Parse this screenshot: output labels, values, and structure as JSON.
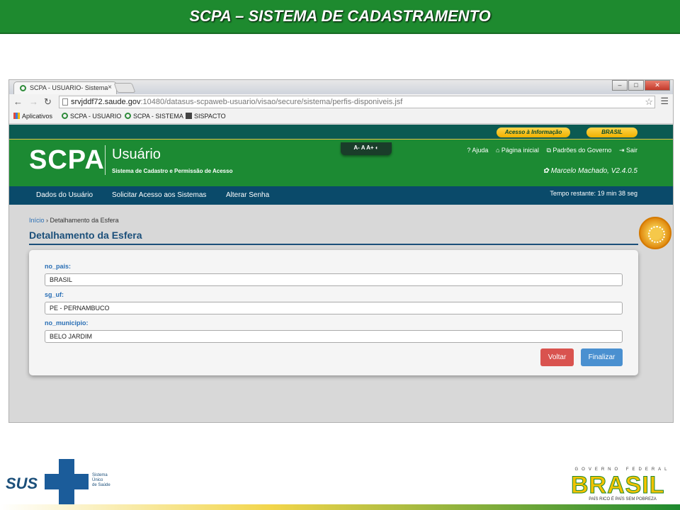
{
  "banner": {
    "title": "SCPA – SISTEMA DE CADASTRAMENTO"
  },
  "browser": {
    "tab_title": "SCPA - USUARIO- Sistema",
    "tab_close": "×",
    "window_controls": {
      "minimize": "–",
      "maximize": "□",
      "close": "✕"
    },
    "url_host": "srvjddf72.saude.gov",
    "url_path": ":10480/datasus-scpaweb-usuario/visao/secure/sistema/perfis-disponiveis.jsf",
    "bookmarks": [
      "Aplicativos",
      "SCPA - USUARIO",
      "SCPA - SISTEMA",
      "SISPACTO"
    ]
  },
  "site": {
    "acesso_info": "Acesso à Informação",
    "brasil_pill": "BRASIL",
    "logo": "SCPA",
    "subtitle": "Usuário",
    "subdesc": "Sistema de Cadastro e Permissão de Acesso",
    "font_controls": "A-  A  A+  ◐",
    "links": {
      "ajuda": "? Ajuda",
      "inicial": "⌂ Página inicial",
      "padroes": "⧉ Padrões do Governo",
      "sair": "⇥ Sair"
    },
    "user": "Marcelo Machado, V2.4.0.5",
    "menu": [
      "Dados do Usuário",
      "Solicitar Acesso aos Sistemas",
      "Alterar Senha"
    ],
    "timer": "Tempo restante: 19 min 38 seg"
  },
  "content": {
    "breadcrumb_home": "Início",
    "breadcrumb_current": "Detalhamento da Esfera",
    "title": "Detalhamento da Esfera",
    "fields": [
      {
        "label": "no_pais:",
        "value": "BRASIL"
      },
      {
        "label": "sg_uf:",
        "value": "PE - PERNAMBUCO"
      },
      {
        "label": "no_municipio:",
        "value": "BELO JARDIM"
      }
    ],
    "btn_voltar": "Voltar",
    "btn_finalizar": "Finalizar"
  },
  "footer": {
    "sus": "SUS",
    "sus_sub": [
      "Sistema",
      "Único",
      "de Saúde"
    ],
    "gov_top": "GOVERNO FEDERAL",
    "brasil": "BRASIL",
    "gov_bottom": "PAÍS RICO É PAÍS SEM POBREZA"
  }
}
